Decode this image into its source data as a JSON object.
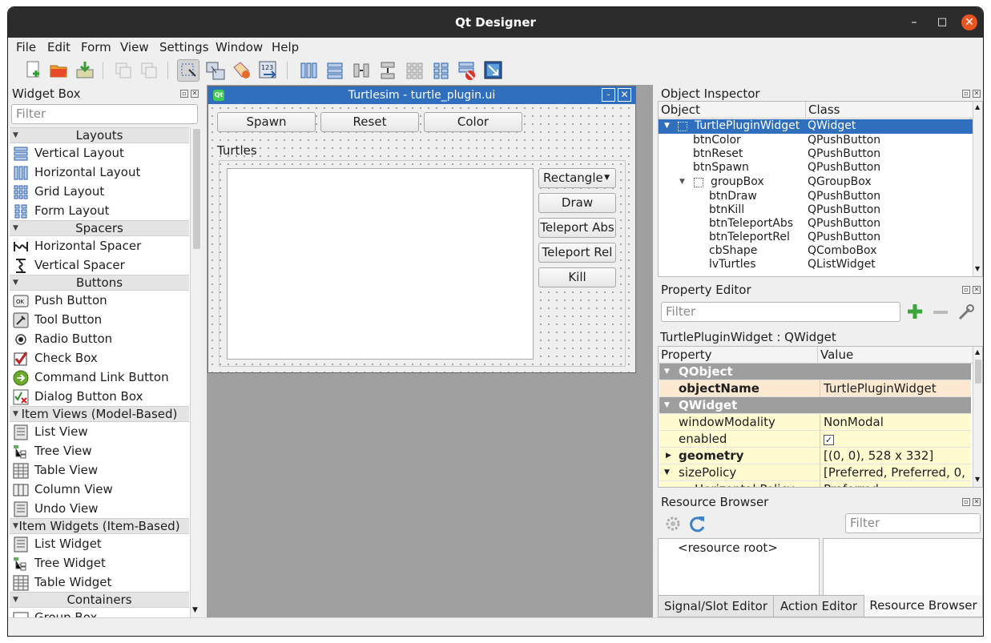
{
  "window": {
    "title": "Qt Designer",
    "min": "–",
    "max": "□",
    "close": "✕"
  },
  "menubar": [
    "File",
    "Edit",
    "Form",
    "View",
    "Settings",
    "Window",
    "Help"
  ],
  "toolbar_icons": [
    "new-form-icon",
    "open-form-icon",
    "save-form-icon",
    "cut-icon",
    "copy-icon",
    "edit-widgets-icon",
    "edit-signals-slots-icon",
    "edit-buddies-icon",
    "edit-tab-order-icon",
    "lay-out-horizontally-icon",
    "lay-out-vertically-icon",
    "lay-out-horizontal-splitter-icon",
    "lay-out-vertical-splitter-icon",
    "lay-out-grid-icon",
    "lay-out-form-icon",
    "break-layout-icon",
    "adjust-size-icon"
  ],
  "widget_box": {
    "title": "Widget Box",
    "filter_placeholder": "Filter",
    "categories": {
      "layouts": "Layouts",
      "spacers": "Spacers",
      "buttons": "Buttons",
      "item_views": "Item Views (Model-Based)",
      "item_widgets": "Item Widgets (Item-Based)",
      "containers": "Containers"
    },
    "items": {
      "vertical_layout": "Vertical Layout",
      "horizontal_layout": "Horizontal Layout",
      "grid_layout": "Grid Layout",
      "form_layout": "Form Layout",
      "horizontal_spacer": "Horizontal Spacer",
      "vertical_spacer": "Vertical Spacer",
      "push_button": "Push Button",
      "tool_button": "Tool Button",
      "radio_button": "Radio Button",
      "check_box": "Check Box",
      "command_link_button": "Command Link Button",
      "dialog_button_box": "Dialog Button Box",
      "list_view": "List View",
      "tree_view": "Tree View",
      "table_view": "Table View",
      "column_view": "Column View",
      "undo_view": "Undo View",
      "list_widget": "List Widget",
      "tree_widget": "Tree Widget",
      "table_widget": "Table Widget",
      "group_box": "Group Box"
    }
  },
  "form": {
    "title": "Turtlesim - turtle_plugin.ui",
    "spawn": "Spawn",
    "reset": "Reset",
    "color": "Color",
    "group_title": "Turtles",
    "shape": "Rectangle",
    "draw": "Draw",
    "teleport_abs": "Teleport Abs",
    "teleport_rel": "Teleport Rel",
    "kill": "Kill"
  },
  "object_inspector": {
    "title": "Object Inspector",
    "col_object": "Object",
    "col_class": "Class",
    "rows": [
      {
        "object": "TurtlePluginWidget",
        "class": "QWidget"
      },
      {
        "object": "btnColor",
        "class": "QPushButton"
      },
      {
        "object": "btnReset",
        "class": "QPushButton"
      },
      {
        "object": "btnSpawn",
        "class": "QPushButton"
      },
      {
        "object": "groupBox",
        "class": "QGroupBox"
      },
      {
        "object": "btnDraw",
        "class": "QPushButton"
      },
      {
        "object": "btnKill",
        "class": "QPushButton"
      },
      {
        "object": "btnTeleportAbs",
        "class": "QPushButton"
      },
      {
        "object": "btnTeleportRel",
        "class": "QPushButton"
      },
      {
        "object": "cbShape",
        "class": "QComboBox"
      },
      {
        "object": "lvTurtles",
        "class": "QListWidget"
      }
    ]
  },
  "property_editor": {
    "title": "Property Editor",
    "filter_placeholder": "Filter",
    "context": "TurtlePluginWidget : QWidget",
    "col_property": "Property",
    "col_value": "Value",
    "group_qobject": "QObject",
    "group_qwidget": "QWidget",
    "object_name_key": "objectName",
    "object_name_val": "TurtlePluginWidget",
    "modality_key": "windowModality",
    "modality_val": "NonModal",
    "enabled_key": "enabled",
    "enabled_val": "✓",
    "geometry_key": "geometry",
    "geometry_val": "[(0, 0), 528 x 332]",
    "size_policy_key": "sizePolicy",
    "size_policy_val": "[Preferred, Preferred, 0, 0]",
    "hpolicy_key": "Horizontal Policy",
    "hpolicy_val": "Preferred"
  },
  "resource_browser": {
    "title": "Resource Browser",
    "filter_placeholder": "Filter",
    "root": "<resource root>"
  },
  "tabs": {
    "signal_slot": "Signal/Slot Editor",
    "action": "Action Editor",
    "resource": "Resource Browser"
  },
  "colors": {
    "titlebar": "#2c2c2c",
    "close": "#e95420",
    "selection": "#2f6fbe",
    "group": "#9e9e9e"
  }
}
